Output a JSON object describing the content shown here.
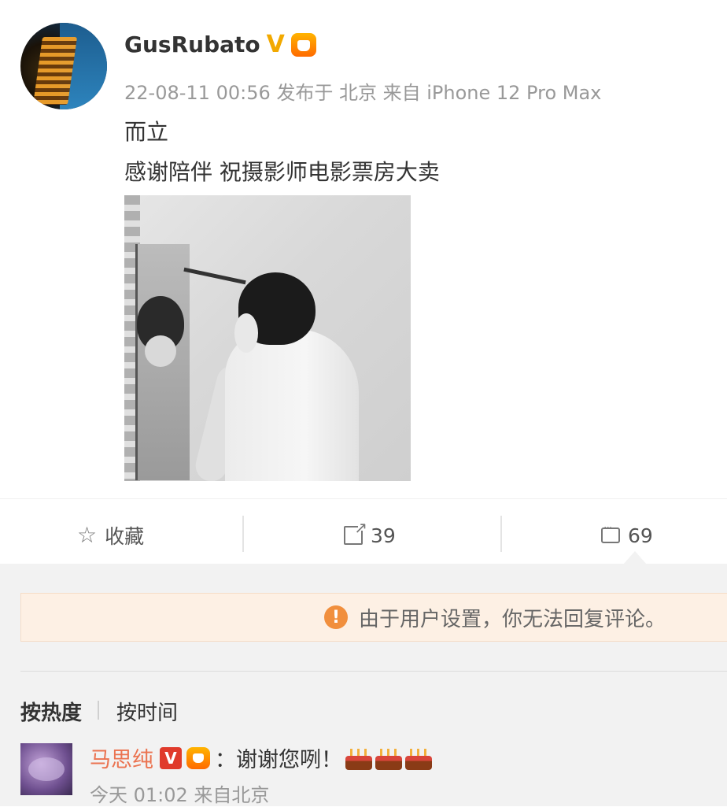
{
  "post": {
    "username": "GusRubato",
    "meta": "22-08-11 00:56 发布于 北京 来自 iPhone 12 Pro Max",
    "line1": "而立",
    "line2": "感谢陪伴 祝摄影师电影票房大卖"
  },
  "actions": {
    "favorite_label": "收藏",
    "share_count": "39",
    "comment_count": "69"
  },
  "notice": {
    "text": "由于用户设置，你无法回复评论。"
  },
  "sort": {
    "by_hot": "按热度",
    "by_time": "按时间"
  },
  "comment": {
    "name": "马思纯",
    "badge": "V",
    "text": "：谢谢您咧！",
    "time": "今天 01:02 来自北京"
  },
  "colors": {
    "accent_name": "#eb7350",
    "notice_bg": "#fdf0e4",
    "warn_icon": "#f18f3d",
    "verified_gold": "#f2a900"
  },
  "icons": [
    "star-icon",
    "share-icon",
    "comment-icon",
    "warning-icon",
    "verified-icon",
    "vip-icon",
    "cake-icon"
  ]
}
